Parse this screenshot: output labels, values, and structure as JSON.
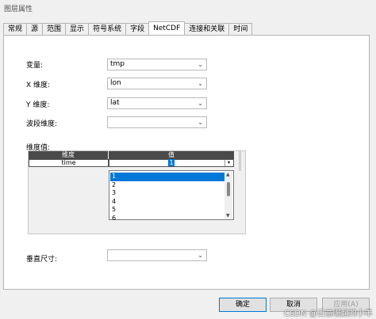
{
  "window": {
    "title": "图层属性"
  },
  "tabs": [
    {
      "label": "常规"
    },
    {
      "label": "源"
    },
    {
      "label": "范围"
    },
    {
      "label": "显示"
    },
    {
      "label": "符号系统"
    },
    {
      "label": "字段"
    },
    {
      "label": "NetCDF"
    },
    {
      "label": "连接和关联"
    },
    {
      "label": "时间"
    }
  ],
  "form": {
    "variable_label": "变量:",
    "variable_value": "tmp",
    "x_label": "X 维度:",
    "x_value": "lon",
    "y_label": "Y 维度:",
    "y_value": "lat",
    "band_label": "波段维度:",
    "band_value": "",
    "dim_values_label": "维度值:",
    "vertical_label": "垂直尺寸:",
    "vertical_value": ""
  },
  "dim_table": {
    "headers": [
      "维度",
      "值"
    ],
    "row": {
      "dimension": "time",
      "value": "1"
    }
  },
  "dropdown": {
    "options": [
      "1",
      "2",
      "3",
      "4",
      "5",
      "6"
    ],
    "selected": "1"
  },
  "buttons": {
    "ok": "确定",
    "cancel": "取消",
    "apply": "应用(A)"
  },
  "watermark": "CSDN @日益崛起的小羊",
  "colors": {
    "selection": "#0078d7",
    "header_bg": "#4a4a4a"
  }
}
